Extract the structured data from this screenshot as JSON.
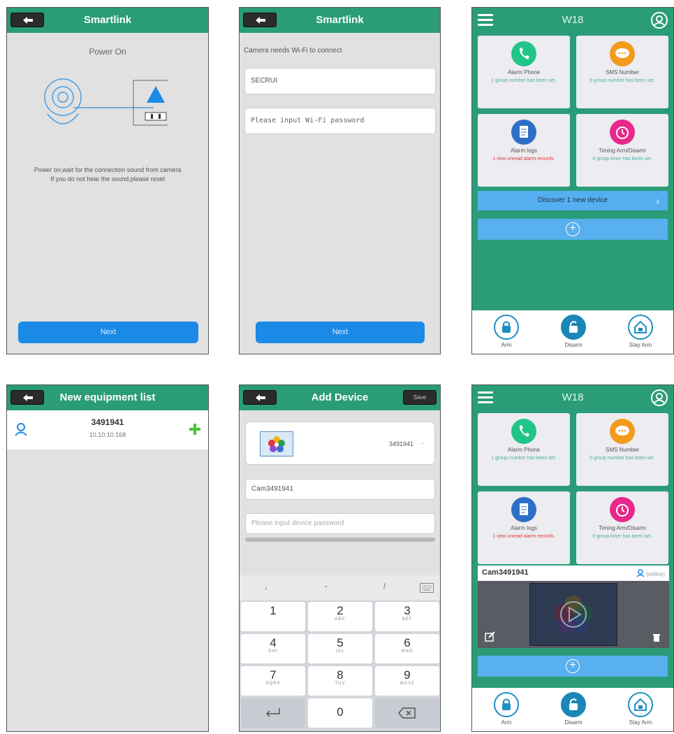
{
  "screens": {
    "s1": {
      "title": "Smartlink",
      "power_title": "Power On",
      "instruction_line1": "Power on,wait for the connection sound from camera",
      "instruction_line2": "If you do not hear the sound,please reset",
      "next_label": "Next"
    },
    "s2": {
      "title": "Smartlink",
      "hint": "Camera needs Wi-Fi to connect",
      "ssid_value": "SECRUI",
      "password_placeholder": "Please input Wi-Fi password",
      "next_label": "Next"
    },
    "s3": {
      "title": "W18",
      "tiles": [
        {
          "name": "Alarm Phone",
          "sub": "1 group number has been set."
        },
        {
          "name": "SMS Number",
          "sub": "0 group number has been set."
        },
        {
          "name": "Alarm logs",
          "sub": "1 new unread alarm records."
        },
        {
          "name": "Timing Arm/Disarm",
          "sub": "0 group timer has been set."
        }
      ],
      "discover_label": "Discover  1  new device",
      "nav": [
        "Arm",
        "Disarm",
        "Stay Arm"
      ]
    },
    "s4": {
      "title": "New equipment list",
      "device_id": "3491941",
      "device_ip": "10.10.10.168"
    },
    "s5": {
      "title": "Add Device",
      "save_label": "Save",
      "device_id": "3491941",
      "name_value": "Cam3491941",
      "password_placeholder": "Please input device password",
      "symbols": [
        ",",
        "-",
        "/"
      ],
      "keys": [
        {
          "n": "1",
          "l": ""
        },
        {
          "n": "2",
          "l": "ABC"
        },
        {
          "n": "3",
          "l": "DEF"
        },
        {
          "n": "4",
          "l": "GHI"
        },
        {
          "n": "5",
          "l": "JKL"
        },
        {
          "n": "6",
          "l": "MNO"
        },
        {
          "n": "7",
          "l": "PQRS"
        },
        {
          "n": "8",
          "l": "TUV"
        },
        {
          "n": "9",
          "l": "WXYZ"
        },
        {
          "n": "0",
          "l": ""
        }
      ]
    },
    "s6": {
      "title": "W18",
      "tiles": [
        {
          "name": "Alarm Phone",
          "sub": "1 group number has been set."
        },
        {
          "name": "SMS Number",
          "sub": "0 group number has been set."
        },
        {
          "name": "Alarm logs",
          "sub": "1 new unread alarm records."
        },
        {
          "name": "Timing Arm/Disarm",
          "sub": "0 group timer has been set."
        }
      ],
      "camera_name": "Cam3491941",
      "camera_status": "(online)",
      "nav": [
        "Arm",
        "Disarm",
        "Stay Arm"
      ]
    }
  },
  "colors": {
    "header_green": "#2a9c78",
    "button_blue": "#1a8ae6",
    "discover_blue": "#55aef0",
    "alarm_red": "#e03a3a"
  }
}
